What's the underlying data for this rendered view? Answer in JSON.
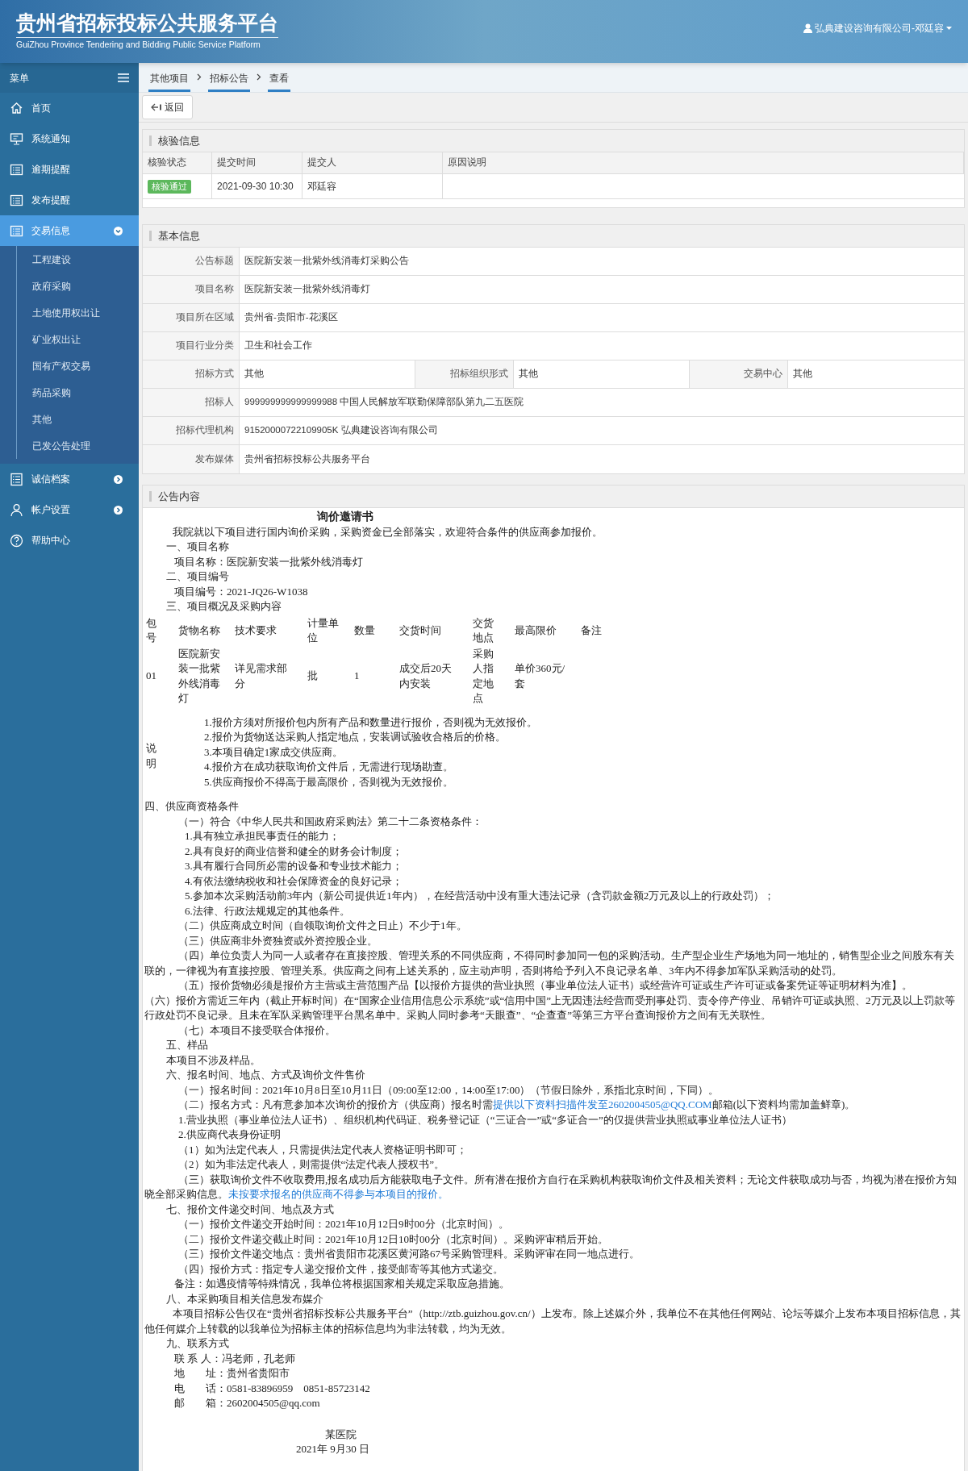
{
  "header": {
    "title": "贵州省招标投标公共服务平台",
    "subtitle": "GuiZhou Province Tendering and Bidding Public Service Platform",
    "user": "弘典建设咨询有限公司-邓廷容"
  },
  "sidebar": {
    "menu_label": "菜单",
    "items": [
      {
        "label": "首页",
        "selected": false
      },
      {
        "label": "系统通知",
        "selected": false
      },
      {
        "label": "逾期提醒",
        "selected": false
      },
      {
        "label": "发布提醒",
        "selected": false
      },
      {
        "label": "交易信息",
        "selected": true,
        "expanded": true,
        "children": [
          {
            "label": "工程建设"
          },
          {
            "label": "政府采购"
          },
          {
            "label": "土地使用权出让"
          },
          {
            "label": "矿业权出让"
          },
          {
            "label": "国有产权交易"
          },
          {
            "label": "药品采购"
          },
          {
            "label": "其他"
          },
          {
            "label": "已发公告处理"
          }
        ]
      },
      {
        "label": "诚信档案",
        "selected": false,
        "expanded": false
      },
      {
        "label": "帐户设置",
        "selected": false,
        "expanded": false
      },
      {
        "label": "帮助中心",
        "selected": false
      }
    ]
  },
  "breadcrumbs": [
    "其他项目",
    "招标公告",
    "查看"
  ],
  "back_button": "返回",
  "verification": {
    "title": "核验信息",
    "columns": [
      "核验状态",
      "提交时间",
      "提交人",
      "原因说明"
    ],
    "rows": [
      {
        "status": "核验通过",
        "passed": true,
        "time": "2021-09-30 10:30",
        "submitter": "邓廷容"
      }
    ]
  },
  "basic_info": {
    "title": "基本信息",
    "rows": [
      {
        "fields": [
          {
            "label": "公告标题",
            "value": "医院新安装一批紫外线消毒灯采购公告"
          }
        ]
      },
      {
        "fields": [
          {
            "label": "项目名称",
            "value": "医院新安装一批紫外线消毒灯"
          }
        ]
      },
      {
        "fields": [
          {
            "label": "项目所在区域",
            "value": "贵州省-贵阳市-花溪区"
          }
        ]
      },
      {
        "fields": [
          {
            "label": "项目行业分类",
            "value": "卫生和社会工作"
          }
        ]
      },
      {
        "fields": [
          {
            "label": "招标方式",
            "value": "其他"
          },
          {
            "label": "招标组织形式",
            "value": "其他"
          },
          {
            "label": "交易中心",
            "value": "其他"
          }
        ]
      },
      {
        "fields": [
          {
            "label": "招标人",
            "value": "999999999999999988 中国人民解放军联勤保障部队第九二五医院"
          }
        ]
      },
      {
        "fields": [
          {
            "label": "招标代理机构",
            "value": "91520000722109905K 弘典建设咨询有限公司"
          }
        ]
      },
      {
        "fields": [
          {
            "label": "发布媒体",
            "value": "贵州省招标投标公共服务平台"
          }
        ]
      }
    ]
  },
  "announcement": {
    "title": "公告内容",
    "blocks": [
      {
        "kind": "title",
        "text": "询价邀请书"
      },
      {
        "kind": "para",
        "text": "我院就以下项目进行国内询价采购，采购资金已全部落实，欢迎符合条件的供应商参加报价。"
      },
      {
        "kind": "section",
        "text": "一、项目名称"
      },
      {
        "kind": "text",
        "text": "项目名称：医院新安装一批紫外线消毒灯"
      },
      {
        "kind": "section",
        "text": "二、项目编号"
      },
      {
        "kind": "text",
        "text": "项目编号：2021-JQ26-W1038"
      },
      {
        "kind": "section",
        "text": "三、项目概况及采购内容"
      },
      {
        "kind": "table",
        "columns": [
          "包号",
          "货物名称",
          "技术要求",
          "计量单位",
          "数量",
          "交货时间",
          "交货地点",
          "最高限价",
          "备注"
        ],
        "rows": [
          [
            "01",
            "医院新安装一批紫外线消毒灯",
            "详见需求部分",
            "批",
            "1",
            "成交后20天内安装",
            "采购人指定地点",
            "单价360元/套"
          ]
        ],
        "notes_label": "说明",
        "notes": [
          "1.报价方须对所报价包内所有产品和数量进行报价，否则视为无效报价。",
          "2.报价为货物送达采购人指定地点，安装调试验收合格后的价格。",
          "3.本项目确定1家成交供应商。",
          "4.报价方在成功获取询价文件后，无需进行现场勘查。",
          "5.供应商报价不得高于最高限价，否则视为无效报价。"
        ]
      },
      {
        "kind": "flush",
        "text": "四、供应商资格条件"
      },
      {
        "kind": "sub",
        "text": "（一）符合《中华人民共和国政府采购法》第二十二条资格条件："
      },
      {
        "kind": "item",
        "text": "1.具有独立承担民事责任的能力；"
      },
      {
        "kind": "item",
        "text": "2.具有良好的商业信誉和健全的财务会计制度；"
      },
      {
        "kind": "item",
        "text": "3.具有履行合同所必需的设备和专业技术能力；"
      },
      {
        "kind": "item",
        "text": "4.有依法缴纳税收和社会保障资金的良好记录；"
      },
      {
        "kind": "item",
        "text": "5.参加本次采购活动前3年内（新公司提供近1年内），在经营活动中没有重大违法记录（含罚款金额2万元及以上的行政处罚）；"
      },
      {
        "kind": "item",
        "text": "6.法律、行政法规规定的其他条件。"
      },
      {
        "kind": "sub",
        "text": "（二）供应商成立时间（自领取询价文件之日止）不少于1年。"
      },
      {
        "kind": "sub",
        "text": "（三）供应商非外资独资或外资控股企业。"
      },
      {
        "kind": "subpara",
        "text": "（四）单位负责人为同一人或者存在直接控股、管理关系的不同供应商，不得同时参加同一包的采购活动。生产型企业生产场地为同一地址的，销售型企业之间股东有关联的，一律视为有直接控股、管理关系。供应商之间有上述关系的，应主动声明，否则将给予列入不良记录名单、3年内不得参加军队采购活动的处罚。"
      },
      {
        "kind": "subpara",
        "text": "（五）报价货物必须是报价方主营或主营范围产品【以报价方提供的营业执照（事业单位法人证书）或经营许可证或生产许可证或备案凭证等证明材料为准】。"
      },
      {
        "kind": "flush",
        "text": "（六）报价方需近三年内（截止开标时间）在“国家企业信用信息公示系统”或“信用中国”上无因违法经营而受刑事处罚、责令停产停业、吊销许可证或执照、2万元及以上罚款等行政处罚不良记录。且未在军队采购管理平台黑名单中。采购人同时参考“天眼查”、“企查查”等第三方平台查询报价方之间有无关联性。"
      },
      {
        "kind": "sub",
        "text": "（七）本项目不接受联合体报价。"
      },
      {
        "kind": "section",
        "text": "五、样品"
      },
      {
        "kind": "section",
        "text": "本项目不涉及样品。"
      },
      {
        "kind": "section",
        "text": "六、报名时间、地点、方式及询价文件售价"
      },
      {
        "kind": "sub",
        "text": "（一）报名时间：2021年10月8日至10月11日（09:00至12:00，14:00至17:00）（节假日除外，系指北京时间，下同）。"
      },
      {
        "kind": "sub",
        "parts": [
          {
            "text": "（二）报名方式：凡有意参加本次询价的报价方（供应商）报名时需",
            "link": false
          },
          {
            "text": "提供以下资料扫描件发至2602004505@QQ.COM",
            "link": true
          },
          {
            "text": "邮箱(以下资料均需加盖鲜章)。",
            "link": false
          }
        ]
      },
      {
        "kind": "sub",
        "text": "1.营业执照（事业单位法人证书）、组织机构代码证、税务登记证（“三证合一”或“多证合一”的仅提供营业执照或事业单位法人证书）"
      },
      {
        "kind": "sub",
        "text": "2.供应商代表身份证明"
      },
      {
        "kind": "sub",
        "text": "（1）如为法定代表人，只需提供法定代表人资格证明书即可；"
      },
      {
        "kind": "sub",
        "text": "（2）如为非法定代表人，则需提供“法定代表人授权书”。"
      },
      {
        "kind": "subpara",
        "parts": [
          {
            "text": "（三）获取询价文件不收取费用,报名成功后方能获取电子文件。所有潜在报价方自行在采购机构获取询价文件及相关资料；无论文件获取成功与否，均视为潜在报价方知晓全部采购信息。",
            "link": false
          },
          {
            "text": "未按要求报名的供应商不得参与本项目的报价。",
            "link": true
          }
        ]
      },
      {
        "kind": "section",
        "text": "七、报价文件递交时间、地点及方式"
      },
      {
        "kind": "sub",
        "text": "（一）报价文件递交开始时间：2021年10月12日9时00分（北京时间）。"
      },
      {
        "kind": "sub",
        "text": "（二）报价文件递交截止时间：2021年10月12日10时00分（北京时间）。采购评审稍后开始。"
      },
      {
        "kind": "sub",
        "text": "（三）报价文件递交地点：贵州省贵阳市花溪区黄河路67号采购管理科。采购评审在同一地点进行。"
      },
      {
        "kind": "sub",
        "text": "（四）报价方式：指定专人递交报价文件，接受邮寄等其他方式递交。"
      },
      {
        "kind": "text",
        "text": "备注：如遇疫情等特殊情况，我单位将根据国家相关规定采取应急措施。"
      },
      {
        "kind": "section",
        "text": "八、本采购项目相关信息发布媒介"
      },
      {
        "kind": "para",
        "text": "本项目招标公告仅在“贵州省招标投标公共服务平台”（http://ztb.guizhou.gov.cn/）上发布。除上述媒介外，我单位不在其他任何网站、论坛等媒介上发布本项目招标信息，其他任何媒介上转载的以我单位为招标主体的招标信息均为非法转载，均为无效。"
      },
      {
        "kind": "section",
        "text": "九、联系方式"
      },
      {
        "kind": "text",
        "text": "联 系 人：冯老师，孔老师"
      },
      {
        "kind": "text",
        "text": "地        址：贵州省贵阳市"
      },
      {
        "kind": "text",
        "text": "电        话：0581-83896959    0851-85723142"
      },
      {
        "kind": "text",
        "text": "邮        箱：2602004505@qq.com"
      },
      {
        "kind": "signer",
        "text": "某医院"
      },
      {
        "kind": "signdate",
        "text": "2021年 9月30 日"
      }
    ]
  }
}
